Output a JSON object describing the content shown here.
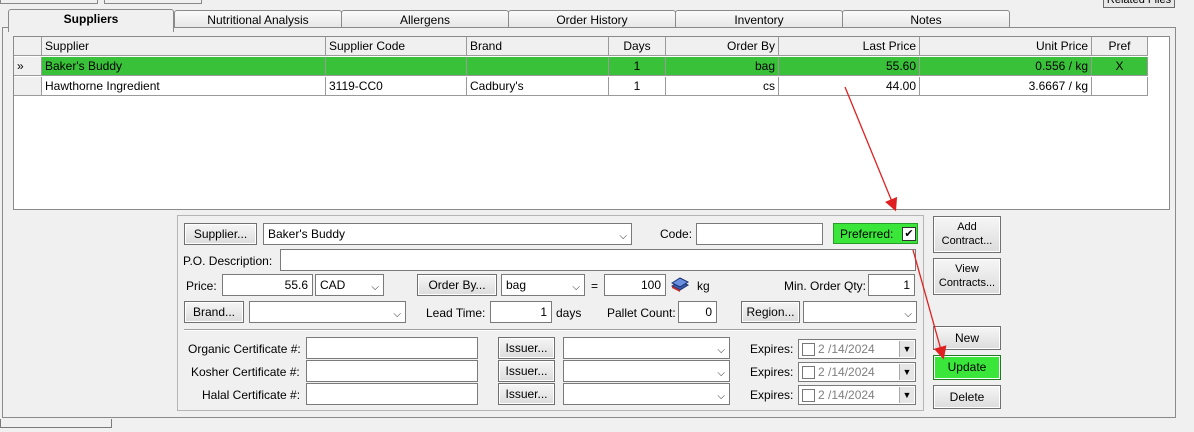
{
  "top": {
    "related_files_label": "Related Files"
  },
  "tabs": [
    {
      "label": "Suppliers",
      "active": true
    },
    {
      "label": "Nutritional Analysis",
      "active": false
    },
    {
      "label": "Allergens",
      "active": false
    },
    {
      "label": "Order History",
      "active": false
    },
    {
      "label": "Inventory",
      "active": false
    },
    {
      "label": "Notes",
      "active": false
    }
  ],
  "grid": {
    "columns": [
      "Supplier",
      "Supplier Code",
      "Brand",
      "Days",
      "Order By",
      "Last Price",
      "Unit Price",
      "Pref"
    ],
    "rows": [
      {
        "indicator": "»",
        "supplier": "Baker's Buddy",
        "code": "",
        "brand": "",
        "days": "1",
        "order_by": "bag",
        "last_price": "55.60",
        "unit_price": "0.556 / kg",
        "pref": "X",
        "selected": true
      },
      {
        "indicator": "",
        "supplier": "Hawthorne Ingredient",
        "code": "3119-CC0",
        "brand": "Cadbury's",
        "days": "1",
        "order_by": "cs",
        "last_price": "44.00",
        "unit_price": "3.6667 / kg",
        "pref": "",
        "selected": false
      }
    ]
  },
  "form": {
    "supplier_button": "Supplier...",
    "supplier_value": "Baker's Buddy",
    "code_label": "Code:",
    "code_value": "",
    "preferred_label": "Preferred:",
    "preferred_checked": true,
    "po_label": "P.O. Description:",
    "po_value": "",
    "price_label": "Price:",
    "price_value": "55.6",
    "currency_value": "CAD",
    "order_by_button": "Order By...",
    "order_by_value": "bag",
    "equals": "=",
    "qty_value": "100",
    "unit": "kg",
    "min_order_label": "Min. Order Qty:",
    "min_order_value": "1",
    "brand_button": "Brand...",
    "brand_value": "",
    "lead_time_label": "Lead Time:",
    "lead_time_value": "1",
    "days_label": "days",
    "pallet_label": "Pallet Count:",
    "pallet_value": "0",
    "region_button": "Region...",
    "region_value": ""
  },
  "certificates": [
    {
      "label": "Organic Certificate #:",
      "value": "",
      "issuer_button": "Issuer...",
      "issuer_value": "",
      "expires_label": "Expires:",
      "expires_value": "2 /14/2024"
    },
    {
      "label": "Kosher Certificate #:",
      "value": "",
      "issuer_button": "Issuer...",
      "issuer_value": "",
      "expires_label": "Expires:",
      "expires_value": "2 /14/2024"
    },
    {
      "label": "Halal Certificate #:",
      "value": "",
      "issuer_button": "Issuer...",
      "issuer_value": "",
      "expires_label": "Expires:",
      "expires_value": "2 /14/2024"
    }
  ],
  "side_buttons": {
    "add_contract": "Add Contract...",
    "view_contracts": "View Contracts...",
    "new": "New",
    "update": "Update",
    "delete": "Delete"
  },
  "colors": {
    "selected_row": "#39c239",
    "preferred_bg": "#39e639",
    "update_bg": "#39e639",
    "annotation_arrow": "#e02020"
  }
}
